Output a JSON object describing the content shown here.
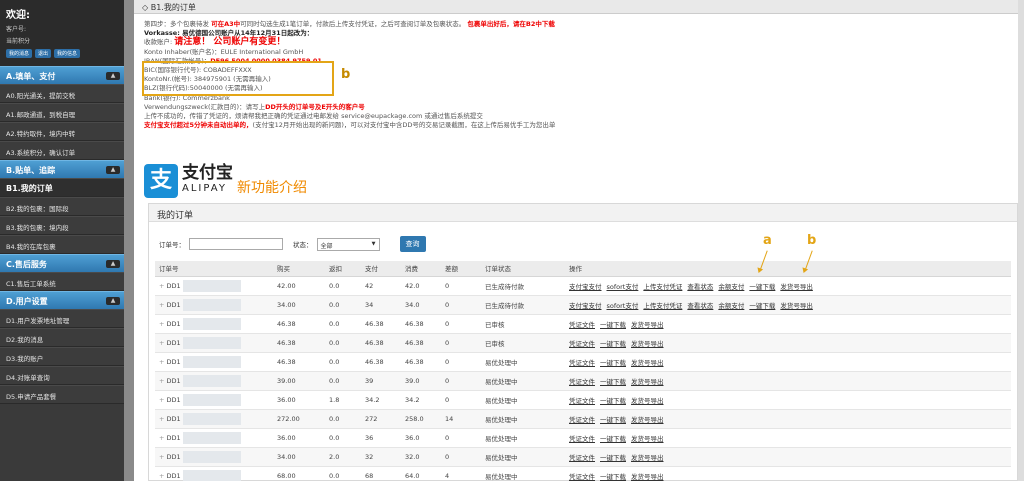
{
  "sidebar": {
    "welcome": "欢迎:",
    "customer_label": "客户号:",
    "points_label": "当前积分",
    "btns": [
      "我的消息",
      "退出",
      "我的信息"
    ],
    "sections": [
      {
        "title": "A.填单、支付",
        "items": [
          "A0.阳光通关，提前交税",
          "A1.邮政通道，到税自理",
          "A2.特约取件，境内中转",
          "A3.系统积分，确认订单"
        ]
      },
      {
        "title": "B.贴单、追踪",
        "items": [
          "B1.我的订单",
          "B2.我的包裹：国际段",
          "B3.我的包裹：境内段",
          "B4.我的在库包裹"
        ]
      },
      {
        "title": "C.售后服务",
        "items": [
          "C1.售后工单系统"
        ]
      },
      {
        "title": "D.用户设置",
        "items": [
          "D1.用户发票地址管理",
          "D2.我的消息",
          "D3.我的账户",
          "D4.对账单查询",
          "D5.申请产品套餐"
        ]
      }
    ],
    "active": "B1.我的订单"
  },
  "page": {
    "title": "B1.我的订单"
  },
  "info": {
    "step": "第四步：多个包裹待发",
    "step_red": "可在A3中",
    "step_rest": "可同时勾选生成1笔订单，付款后上传支付凭证，之后可查阅订单及包裹状态。",
    "step_red2": "包裹单出好后，请在B2中下载",
    "vorkasse": "Vorkasse: 易优德国公司账户从14年12月31日起改为：",
    "receiver": "收款账户:",
    "notice": "请注意！ 公司账户有变更！",
    "konto_inhaber": "Konto Inhaber(账户名)：EULE International GmbH",
    "iban_label": "IBAN(国际汇款帐号)：",
    "iban_value": "DE96 5004 0000 0384 9759 01",
    "bic": "BIC(国际银行代号): COBADEFFXXX",
    "kontonr": "KontoNr.(帐号): 384975901 (无需再输入)",
    "blz": "BLZ(银行代码):50040000 (无需再输入)",
    "bank": "Bank(银行): Commerzbank",
    "verwendung": "Verwendungszweck(汇款目的)：请写上",
    "verwendung_red": "DD开头的订单号及E开头的客户号",
    "upload_note": "上传不成功的，传错了凭证的，烦请帮我把正确的凭证通过电邮发给 service@eupackage.com 或通过售后系统提交",
    "alipay_red": "支付宝支付超过5分钟未自动出单的，",
    "alipay_rest": "(支付宝12月开始出现的新问题)，可以对支付宝中含DD号的交易记录截图，在这上传后易优手工为您出单"
  },
  "alipay": {
    "cn": "支付宝",
    "en": "ALIPAY",
    "feature": "新功能介绍"
  },
  "markers": {
    "a": "a",
    "b": "b"
  },
  "orders": {
    "title": "我的订单",
    "filter": {
      "order_no_label": "订单号：",
      "status_label": "状态：",
      "status_value": "全部",
      "query": "查询"
    },
    "columns": [
      "订单号",
      "购买",
      "返扣",
      "支付",
      "消费",
      "差额",
      "订单状态",
      "操作"
    ],
    "rows": [
      {
        "id": "DD1",
        "buy": "42.00",
        "rebate": "0.0",
        "pay": "42",
        "spend": "42.0",
        "diff": "0",
        "status": "已生成待付款",
        "actions": [
          "支付宝支付",
          "sofort支付",
          "上传支付凭证",
          "查看状态",
          "余额支付",
          "一键下载",
          "发货号导出"
        ]
      },
      {
        "id": "DD1",
        "buy": "34.00",
        "rebate": "0.0",
        "pay": "34",
        "spend": "34.0",
        "diff": "0",
        "status": "已生成待付款",
        "actions": [
          "支付宝支付",
          "sofort支付",
          "上传支付凭证",
          "查看状态",
          "余额支付",
          "一键下载",
          "发货号导出"
        ]
      },
      {
        "id": "DD1",
        "buy": "46.38",
        "rebate": "0.0",
        "pay": "46.38",
        "spend": "46.38",
        "diff": "0",
        "status": "已审核",
        "actions": [
          "凭证文件",
          "一键下载",
          "发货号导出"
        ]
      },
      {
        "id": "DD1",
        "buy": "46.38",
        "rebate": "0.0",
        "pay": "46.38",
        "spend": "46.38",
        "diff": "0",
        "status": "已审核",
        "actions": [
          "凭证文件",
          "一键下载",
          "发货号导出"
        ]
      },
      {
        "id": "DD1",
        "buy": "46.38",
        "rebate": "0.0",
        "pay": "46.38",
        "spend": "46.38",
        "diff": "0",
        "status": "易优处理中",
        "actions": [
          "凭证文件",
          "一键下载",
          "发货号导出"
        ]
      },
      {
        "id": "DD1",
        "buy": "39.00",
        "rebate": "0.0",
        "pay": "39",
        "spend": "39.0",
        "diff": "0",
        "status": "易优处理中",
        "actions": [
          "凭证文件",
          "一键下载",
          "发货号导出"
        ]
      },
      {
        "id": "DD1",
        "buy": "36.00",
        "rebate": "1.8",
        "pay": "34.2",
        "spend": "34.2",
        "diff": "0",
        "status": "易优处理中",
        "actions": [
          "凭证文件",
          "一键下载",
          "发货号导出"
        ]
      },
      {
        "id": "DD1",
        "buy": "272.00",
        "rebate": "0.0",
        "pay": "272",
        "spend": "258.0",
        "diff": "14",
        "status": "易优处理中",
        "actions": [
          "凭证文件",
          "一键下载",
          "发货号导出"
        ]
      },
      {
        "id": "DD1",
        "buy": "36.00",
        "rebate": "0.0",
        "pay": "36",
        "spend": "36.0",
        "diff": "0",
        "status": "易优处理中",
        "actions": [
          "凭证文件",
          "一键下载",
          "发货号导出"
        ]
      },
      {
        "id": "DD1",
        "buy": "34.00",
        "rebate": "2.0",
        "pay": "32",
        "spend": "32.0",
        "diff": "0",
        "status": "易优处理中",
        "actions": [
          "凭证文件",
          "一键下载",
          "发货号导出"
        ]
      },
      {
        "id": "DD1",
        "buy": "68.00",
        "rebate": "0.0",
        "pay": "68",
        "spend": "64.0",
        "diff": "4",
        "status": "易优处理中",
        "actions": [
          "凭证文件",
          "一键下载",
          "发货号导出"
        ]
      }
    ]
  }
}
